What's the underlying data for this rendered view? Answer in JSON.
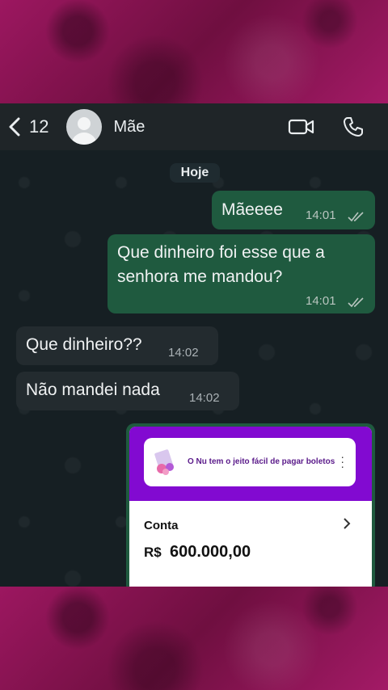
{
  "header": {
    "back_count": "12",
    "contact_name": "Mãe",
    "icons": [
      "chevron-left-icon",
      "avatar",
      "video-call-icon",
      "phone-icon"
    ]
  },
  "chat": {
    "day_label": "Hoje",
    "messages": [
      {
        "direction": "out",
        "text": "Mãeeee",
        "time": "14:01",
        "status": "read"
      },
      {
        "direction": "out",
        "text_line1": "Que dinheiro foi esse que a",
        "text_line2": "senhora me mandou?",
        "time": "14:01",
        "status": "read"
      },
      {
        "direction": "in",
        "text": "Que dinheiro??",
        "time": "14:02"
      },
      {
        "direction": "in",
        "text": "Não mandei nada",
        "time": "14:02"
      }
    ],
    "image_message": {
      "banner_text": "O Nu tem o jeito fácil de pagar boletos",
      "account_label": "Conta",
      "currency": "R$",
      "amount": "600.000,00"
    }
  },
  "colors": {
    "outgoing_bubble": "#1f5a3f",
    "incoming_bubble": "#232b2f",
    "nubank_purple": "#820ad1",
    "frame_magenta": "#8a1452"
  }
}
